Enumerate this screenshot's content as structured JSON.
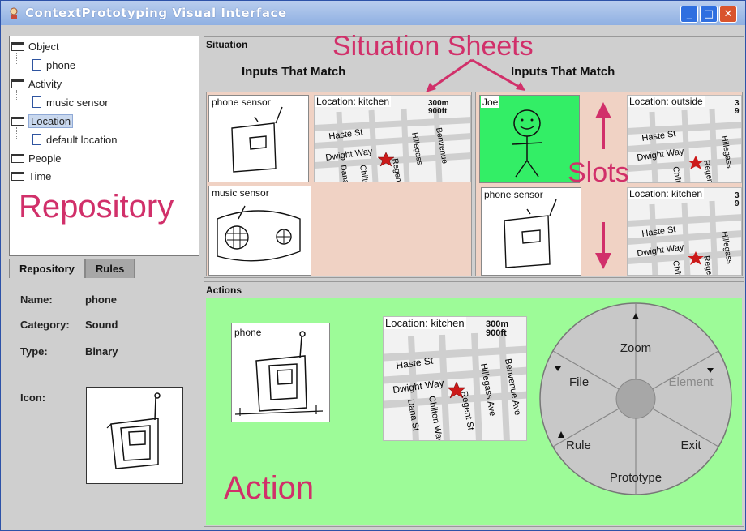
{
  "window": {
    "title": "ContextPrototyping Visual Interface",
    "min": "_",
    "max": "□",
    "close": "✕"
  },
  "tree": [
    {
      "label": "Object",
      "kind": "folder"
    },
    {
      "label": "phone",
      "kind": "doc"
    },
    {
      "label": "Activity",
      "kind": "folder"
    },
    {
      "label": "music sensor",
      "kind": "doc"
    },
    {
      "label": "Location",
      "kind": "folder",
      "selected": true
    },
    {
      "label": "default location",
      "kind": "doc"
    },
    {
      "label": "People",
      "kind": "folder"
    },
    {
      "label": "Time",
      "kind": "folder"
    }
  ],
  "annotations": {
    "repository": "Repository",
    "situation_sheets": "Situation Sheets",
    "slots": "Slots",
    "action": "Action"
  },
  "tabs": {
    "repository": "Repository",
    "rules": "Rules"
  },
  "properties": {
    "name_label": "Name:",
    "name_value": "phone",
    "category_label": "Category:",
    "category_value": "Sound",
    "type_label": "Type:",
    "type_value": "Binary",
    "icon_label": "Icon:"
  },
  "situation": {
    "title": "Situation",
    "left_header": "Inputs That Match",
    "right_header": "Inputs That Match",
    "sheet1": {
      "slot1_label": "phone sensor",
      "slot2_label": "music sensor",
      "map_loc": "Location: kitchen"
    },
    "sheet2": {
      "slot1_label": "Joe",
      "slot2_label": "phone sensor",
      "map1_loc": "Location: outside",
      "map2_loc": "Location: kitchen"
    }
  },
  "map_labels": {
    "scale_m": "300m",
    "scale_ft": "900ft",
    "scale_m_cut": "3",
    "scale_ft_cut": "9",
    "haste": "Haste St",
    "dwight": "Dwight Way",
    "hillegass": "Hillegass",
    "hillegass_ave": "Hillegass Ave",
    "benvenue": "Benvenue",
    "benvenue_ave": "Benvenue Ave",
    "dana": "Dana",
    "dana_st": "Dana St",
    "chilton": "Chilton",
    "chilton_way": "Chilton Way",
    "regent": "Regent",
    "regent_st": "Regent St"
  },
  "actions": {
    "title": "Actions",
    "sketch_label": "phone",
    "map_loc": "Location: kitchen"
  },
  "pie_menu": {
    "zoom": "Zoom",
    "file": "File",
    "element": "Element",
    "rule": "Rule",
    "exit": "Exit",
    "prototype": "Prototype"
  },
  "colors": {
    "accent": "#d1306a",
    "green": "#9dfb98",
    "slot": "#f0d2c4",
    "joe_green": "#33ee66",
    "star": "#cc1a1a"
  }
}
